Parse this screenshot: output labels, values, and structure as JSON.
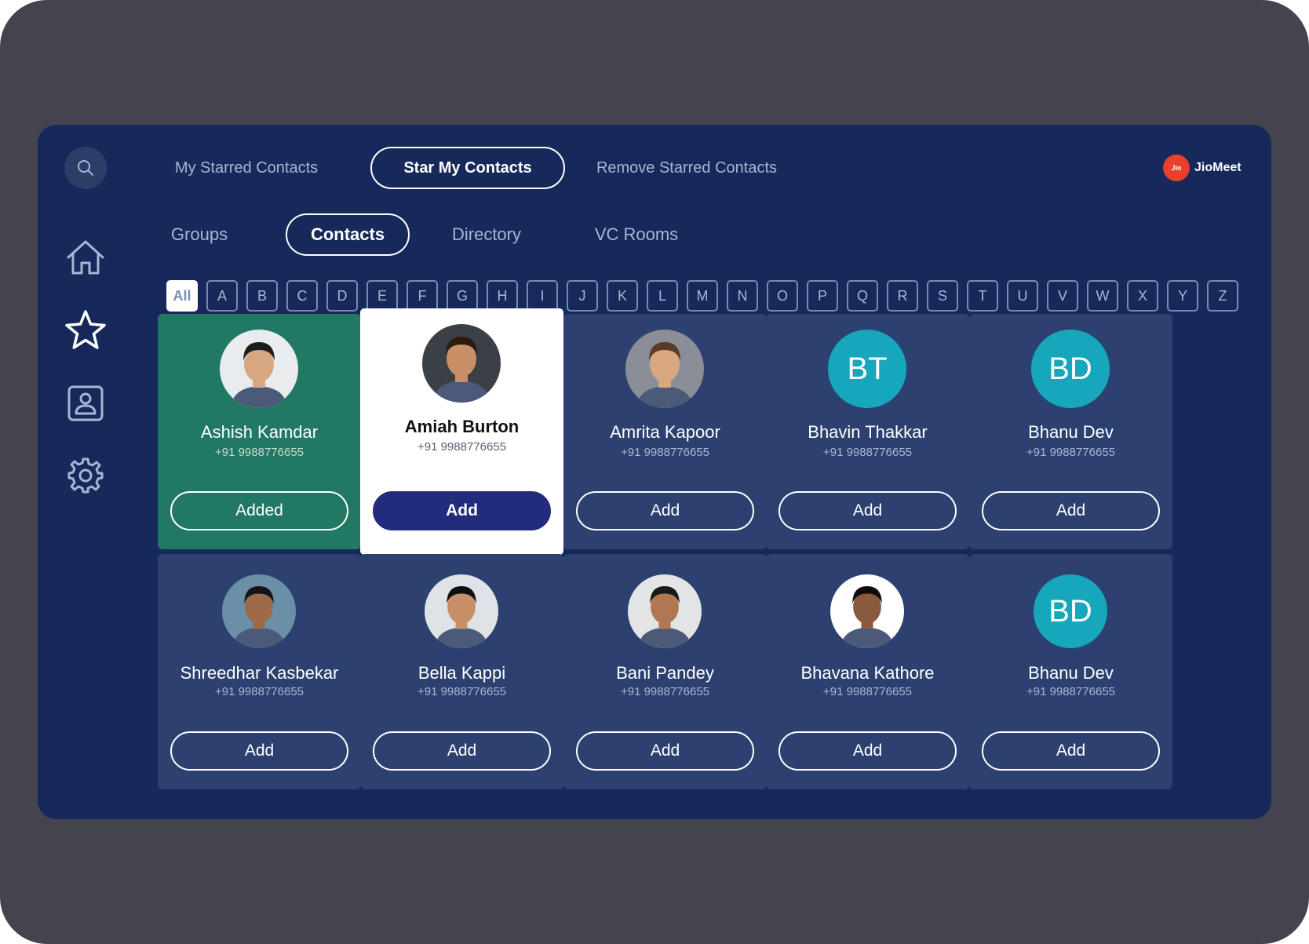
{
  "brand": {
    "logo_text": "Jio",
    "name": "JioMeet",
    "accent": "#e8402b"
  },
  "top_tabs": [
    {
      "label": "My Starred Contacts",
      "active": false
    },
    {
      "label": "Star My Contacts",
      "active": true
    },
    {
      "label": "Remove Starred Contacts",
      "active": false
    }
  ],
  "sub_tabs": [
    {
      "label": "Groups",
      "active": false
    },
    {
      "label": "Contacts",
      "active": true
    },
    {
      "label": "Directory",
      "active": false
    },
    {
      "label": "VC Rooms",
      "active": false
    }
  ],
  "alphabet": [
    "All",
    "A",
    "B",
    "C",
    "D",
    "E",
    "F",
    "G",
    "H",
    "I",
    "J",
    "K",
    "L",
    "M",
    "N",
    "O",
    "P",
    "Q",
    "R",
    "S",
    "T",
    "U",
    "V",
    "W",
    "X",
    "Y",
    "Z"
  ],
  "alphabet_selected": "All",
  "rail": [
    "search-icon",
    "home-icon",
    "star-icon",
    "contact-card-icon",
    "gear-icon"
  ],
  "contacts": [
    {
      "name": "Ashish Kamdar",
      "phone": "+91 9988776655",
      "button": "Added",
      "state": "added",
      "avatar": "photo"
    },
    {
      "name": "Amiah Burton",
      "phone": "+91 9988776655",
      "button": "Add",
      "state": "focused",
      "avatar": "photo"
    },
    {
      "name": "Amrita Kapoor",
      "phone": "+91 9988776655",
      "button": "Add",
      "state": "normal",
      "avatar": "photo"
    },
    {
      "name": "Bhavin Thakkar",
      "phone": "+91 9988776655",
      "button": "Add",
      "state": "normal",
      "avatar": "BT"
    },
    {
      "name": "Bhanu Dev",
      "phone": "+91 9988776655",
      "button": "Add",
      "state": "normal",
      "avatar": "BD"
    },
    {
      "name": "Shreedhar Kasbekar",
      "phone": "+91 9988776655",
      "button": "Add",
      "state": "normal",
      "avatar": "photo"
    },
    {
      "name": "Bella Kappi",
      "phone": "+91 9988776655",
      "button": "Add",
      "state": "normal",
      "avatar": "photo"
    },
    {
      "name": "Bani Pandey",
      "phone": "+91 9988776655",
      "button": "Add",
      "state": "normal",
      "avatar": "photo"
    },
    {
      "name": "Bhavana Kathore",
      "phone": "+91 9988776655",
      "button": "Add",
      "state": "normal",
      "avatar": "photo"
    },
    {
      "name": "Bhanu Dev",
      "phone": "+91 9988776655",
      "button": "Add",
      "state": "normal",
      "avatar": "BD"
    }
  ],
  "colors": {
    "screen_bg": "#16295a",
    "card_bg": "#2d4170",
    "added_bg": "#217863",
    "focused_btn": "#232b7c",
    "initials_bg": "#16a7bd"
  }
}
